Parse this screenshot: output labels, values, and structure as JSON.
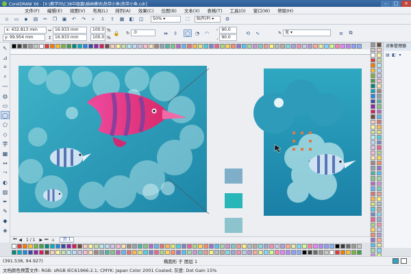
{
  "window": {
    "title": "CorelDRAW X6 - [X:\\教学问\\C38中级篇\\插画模块\\热带小鱼\\热带小鱼.cdr]"
  },
  "menu": [
    "文件(F)",
    "编辑(E)",
    "视图(V)",
    "布局(L)",
    "排列(A)",
    "效果(C)",
    "位图(B)",
    "文本(X)",
    "表格(T)",
    "工具(O)",
    "窗口(W)",
    "帮助(H)"
  ],
  "toolbar": {
    "zoom": "50%",
    "snap": "贴齐(P)"
  },
  "props": {
    "x": "x: 432.813 mm",
    "y": "y: 99.954 mm",
    "w": "16.933 mm",
    "h": "16.933 mm",
    "scale_w": "100.0",
    "scale_h": "100.0",
    "angle": ".0",
    "start_angle": "90.0",
    "end_angle": "90.0",
    "outline": "无",
    "pct": "%"
  },
  "docker": {
    "title": "对象管理器"
  },
  "pagebar": {
    "pages": "1 / 1",
    "tab": "页 1"
  },
  "status": {
    "coords": "(391.538, 94.927)",
    "selection": "椭圆形 于 图层 1",
    "profile": "文档颜色预置文件: RGB: sRGB IEC61966-2.1; CMYK: Japan Color 2001 Coated; 灰度: Dot Gain 15%"
  },
  "colors": {
    "accent": "#2b5a92",
    "ocean_deep": "#1f8fb0",
    "ocean_light": "#8fd3dc",
    "fish_pink": "#e5337b",
    "fish_purple": "#7a3f9e",
    "swatch1": "#7faec8",
    "swatch2": "#28b6b8",
    "swatch3": "#8cc3cc"
  }
}
